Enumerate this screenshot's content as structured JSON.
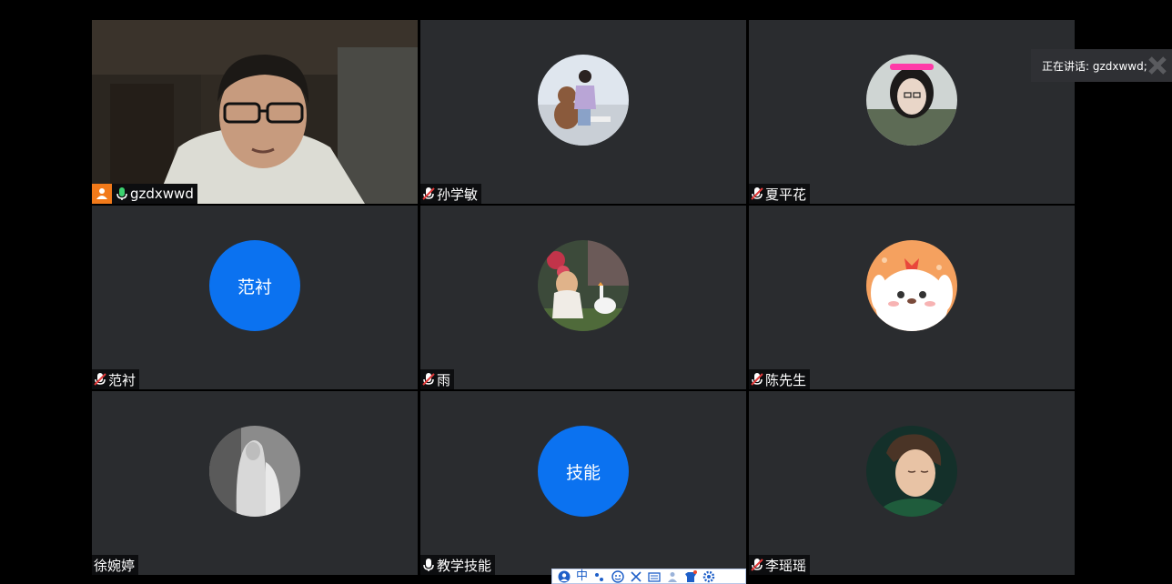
{
  "speaker": {
    "text": "正在讲话: gzdxwwd;"
  },
  "participants": [
    {
      "name": "gzdxwwd",
      "mic": "on"
    },
    {
      "name": "孙学敏",
      "mic": "muted"
    },
    {
      "name": "夏平花",
      "mic": "muted"
    },
    {
      "name": "范衬",
      "mic": "muted",
      "avatar_text": "范衬"
    },
    {
      "name": "雨",
      "mic": "muted"
    },
    {
      "name": "陈先生",
      "mic": "muted"
    },
    {
      "name": "徐婉婷",
      "mic": "none"
    },
    {
      "name": "教学技能",
      "mic": "on-white",
      "avatar_text": "技能"
    },
    {
      "name": "李瑶瑶",
      "mic": "muted"
    }
  ],
  "ime_toolbar": {
    "mode_label": "中"
  },
  "colors": {
    "active_border": "#36c26a",
    "avatar_blue": "#0b72f0",
    "host_badge": "#f27a1a",
    "tile_bg": "#2a2c2f"
  }
}
